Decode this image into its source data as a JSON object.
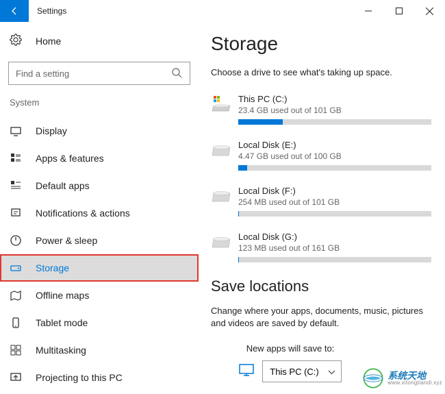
{
  "window": {
    "title": "Settings"
  },
  "sidebar": {
    "home_label": "Home",
    "search_placeholder": "Find a setting",
    "section_header": "System",
    "items": [
      {
        "label": "Display"
      },
      {
        "label": "Apps & features"
      },
      {
        "label": "Default apps"
      },
      {
        "label": "Notifications & actions"
      },
      {
        "label": "Power & sleep"
      },
      {
        "label": "Storage"
      },
      {
        "label": "Offline maps"
      },
      {
        "label": "Tablet mode"
      },
      {
        "label": "Multitasking"
      },
      {
        "label": "Projecting to this PC"
      }
    ]
  },
  "main": {
    "page_title": "Storage",
    "subtitle": "Choose a drive to see what's taking up space.",
    "drives": [
      {
        "name": "This PC (C:)",
        "usage_text": "23.4 GB used out of 101 GB",
        "pct": 23.2,
        "windows": true
      },
      {
        "name": "Local Disk (E:)",
        "usage_text": "4.47 GB used out of 100 GB",
        "pct": 4.5,
        "windows": false
      },
      {
        "name": "Local Disk (F:)",
        "usage_text": "254 MB used out of 101 GB",
        "pct": 0.25,
        "windows": false
      },
      {
        "name": "Local Disk (G:)",
        "usage_text": "123 MB used out of 161 GB",
        "pct": 0.07,
        "windows": false
      }
    ],
    "save_locations": {
      "title": "Save locations",
      "desc": "Change where your apps, documents, music, pictures and videos are saved by default.",
      "new_apps_label": "New apps will save to:",
      "new_apps_value": "This PC (C:)"
    }
  },
  "watermark": {
    "line1": "系统天地",
    "line2": "www.xitongtiandi.xyz"
  }
}
